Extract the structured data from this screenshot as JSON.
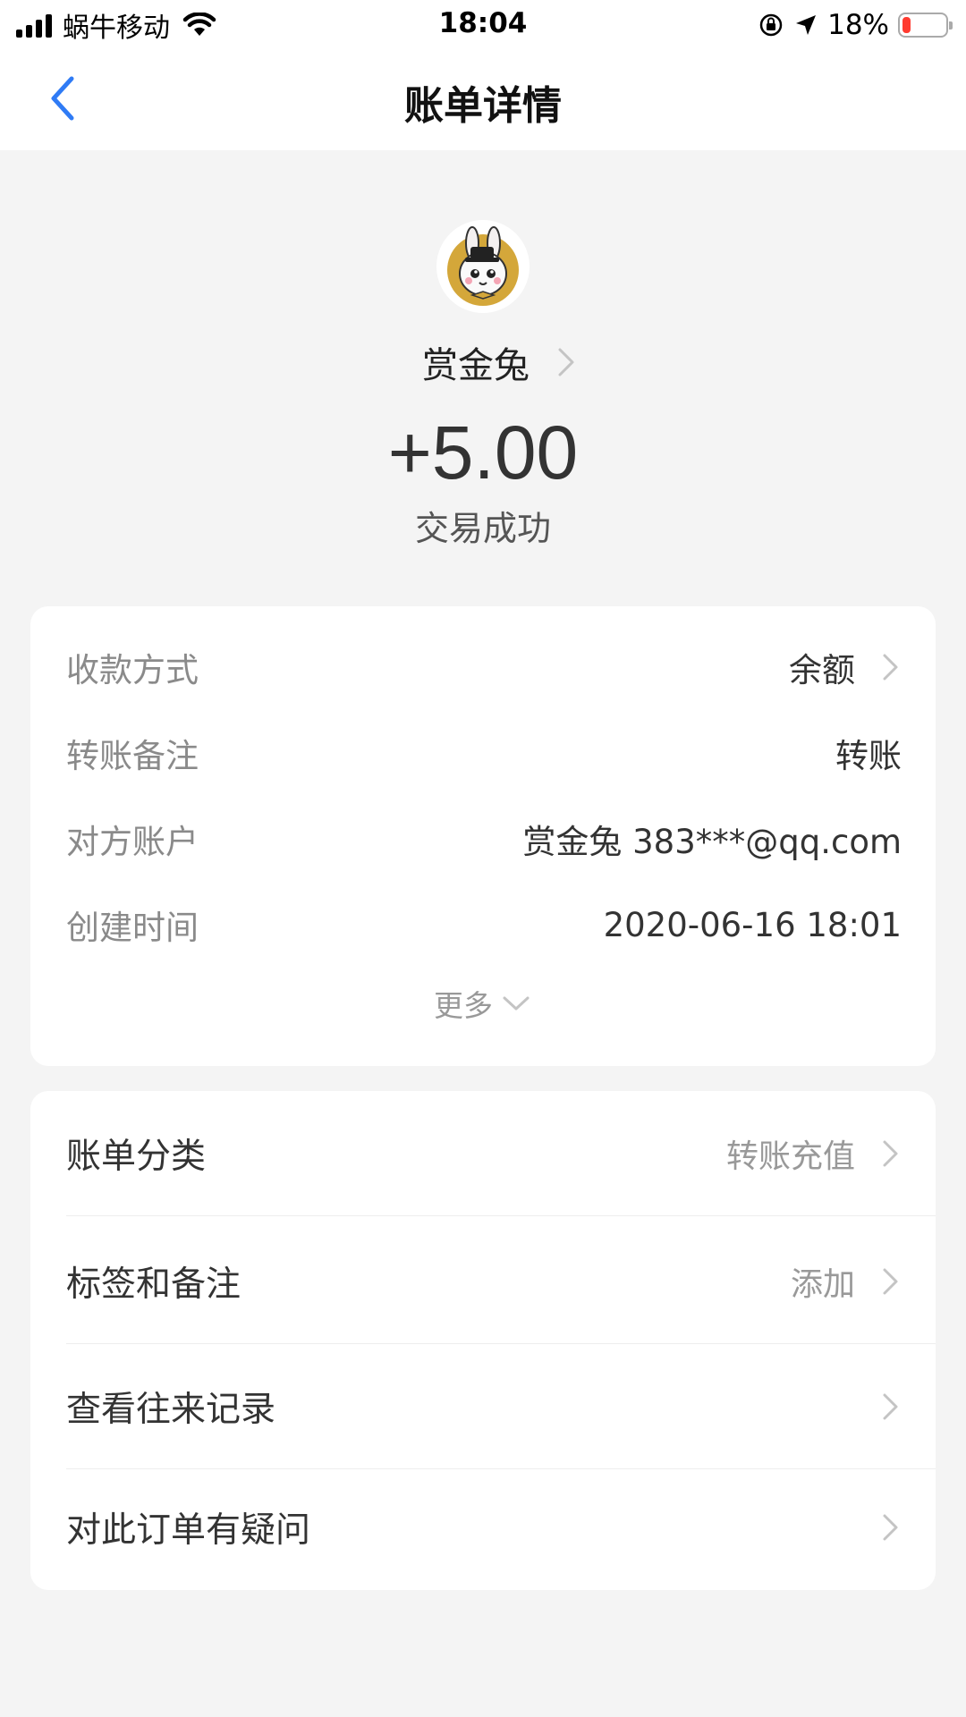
{
  "status_bar": {
    "carrier": "蜗牛移动",
    "time": "18:04",
    "battery_percent": "18%",
    "battery_level": 0.18,
    "battery_color": "#ff3b30"
  },
  "nav": {
    "title": "账单详情",
    "back_icon": "chevron-left-icon",
    "accent": "#2f7bf5"
  },
  "header": {
    "avatar_icon": "rabbit-avatar",
    "payee_name": "赏金兔",
    "amount": "+5.00",
    "status": "交易成功"
  },
  "details": {
    "rows": [
      {
        "label": "收款方式",
        "value": "余额",
        "has_chevron": true
      },
      {
        "label": "转账备注",
        "value": "转账",
        "has_chevron": false
      },
      {
        "label": "对方账户",
        "value": "赏金兔 383***@qq.com",
        "has_chevron": false
      },
      {
        "label": "创建时间",
        "value": "2020-06-16 18:01",
        "has_chevron": false
      }
    ],
    "more_label": "更多"
  },
  "actions": {
    "items": [
      {
        "label": "账单分类",
        "value": "转账充值"
      },
      {
        "label": "标签和备注",
        "value": "添加"
      },
      {
        "label": "查看往来记录",
        "value": ""
      },
      {
        "label": "对此订单有疑问",
        "value": ""
      }
    ]
  }
}
